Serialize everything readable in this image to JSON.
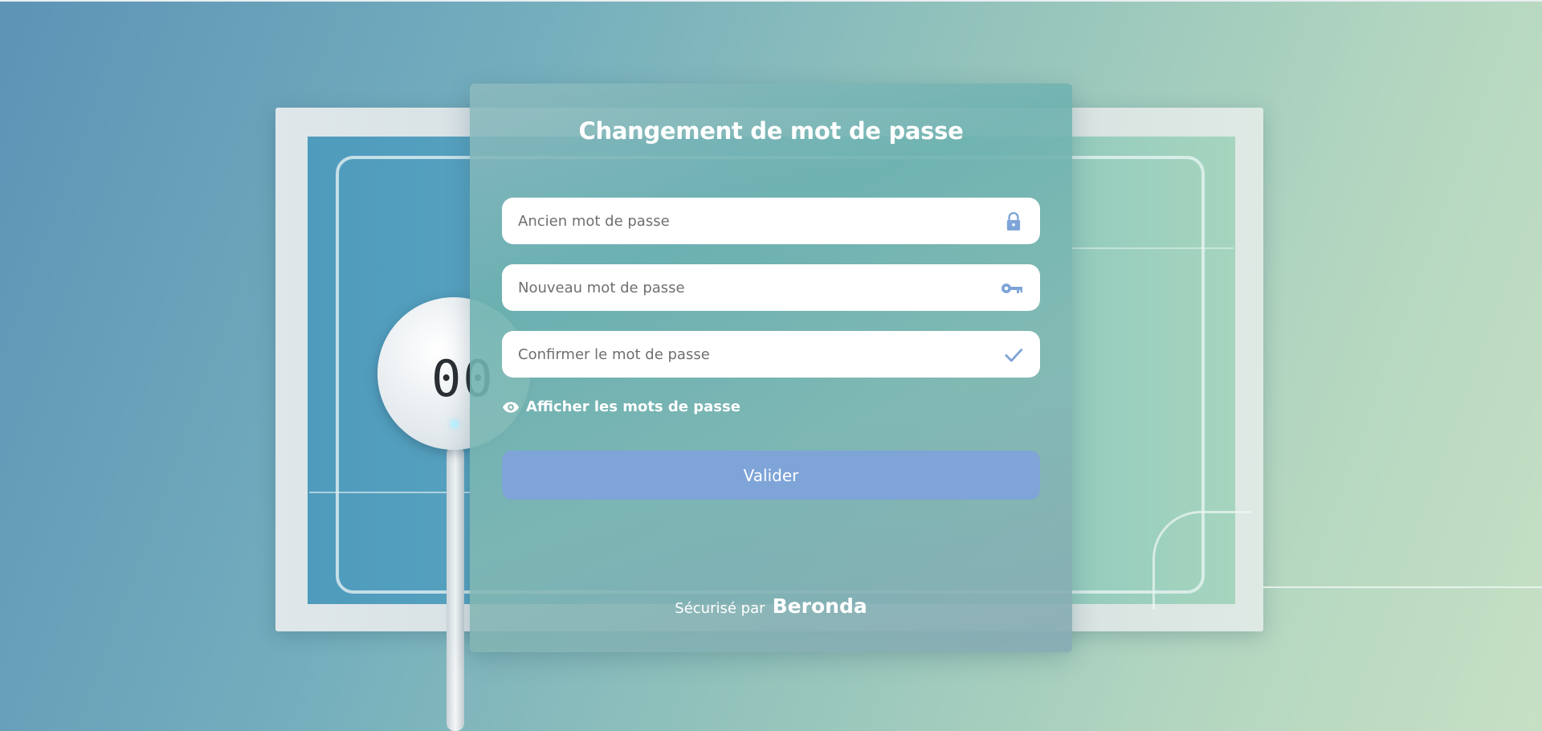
{
  "form": {
    "title": "Changement de mot de passe",
    "old_password": {
      "placeholder": "Ancien mot de passe",
      "value": "",
      "icon": "lock-icon"
    },
    "new_password": {
      "placeholder": "Nouveau mot de passe",
      "value": "",
      "icon": "key-icon"
    },
    "confirm_password": {
      "placeholder": "Confirmer le mot de passe",
      "value": "",
      "icon": "check-icon"
    },
    "show_passwords": {
      "label": "Afficher les mots de passe",
      "icon": "eye-icon"
    },
    "submit_label": "Valider"
  },
  "footer": {
    "secured_by": "Sécurisé par",
    "brand": "Beronda"
  },
  "background": {
    "device_display": "00"
  },
  "colors": {
    "accent": "#7ea4d8",
    "icon": "#7ea4d8",
    "card_text": "#ffffff"
  }
}
